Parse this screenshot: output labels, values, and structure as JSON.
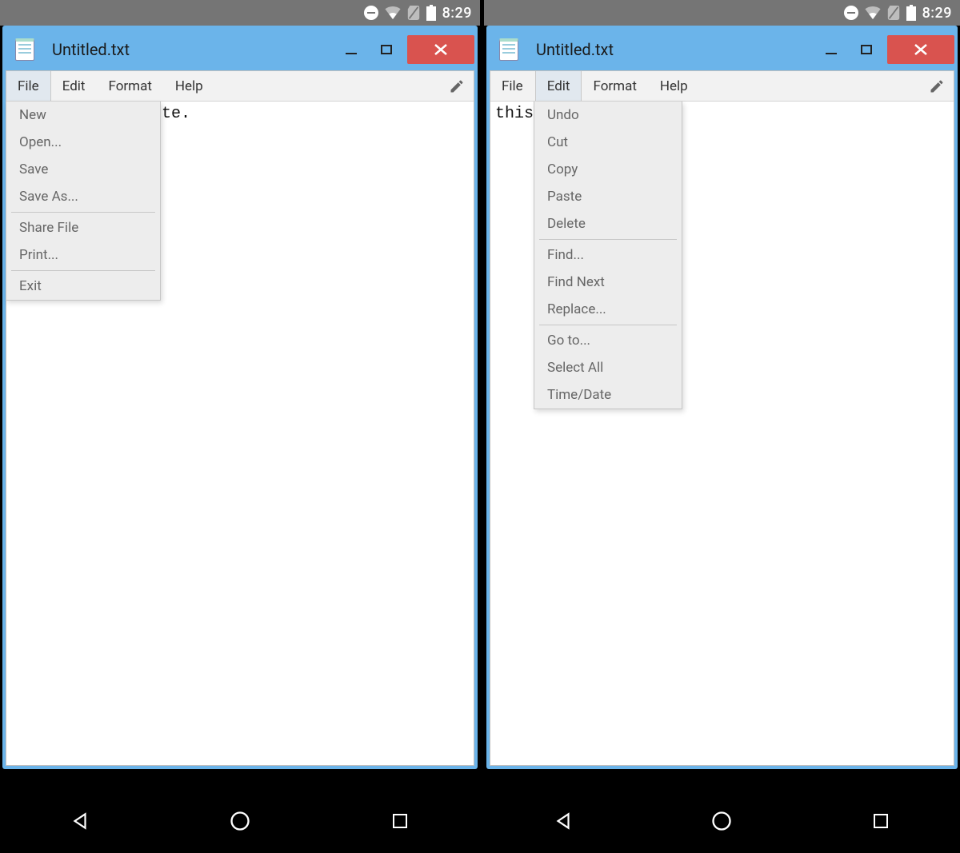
{
  "status": {
    "time": "8:29"
  },
  "left": {
    "title": "Untitled.txt",
    "menubar": {
      "file": "File",
      "edit": "Edit",
      "format": "Format",
      "help": "Help"
    },
    "text_visible": "te.",
    "file_menu": {
      "items": [
        {
          "label": "New"
        },
        {
          "label": "Open..."
        },
        {
          "label": "Save"
        },
        {
          "label": "Save As..."
        },
        {
          "sep": true
        },
        {
          "label": "Share File"
        },
        {
          "label": "Print..."
        },
        {
          "sep": true
        },
        {
          "label": "Exit"
        }
      ]
    }
  },
  "right": {
    "title": "Untitled.txt",
    "menubar": {
      "file": "File",
      "edit": "Edit",
      "format": "Format",
      "help": "Help"
    },
    "text_visible": "this",
    "edit_menu": {
      "items": [
        {
          "label": "Undo"
        },
        {
          "label": "Cut"
        },
        {
          "label": "Copy"
        },
        {
          "label": "Paste"
        },
        {
          "label": "Delete"
        },
        {
          "sep": true
        },
        {
          "label": "Find..."
        },
        {
          "label": "Find Next"
        },
        {
          "label": "Replace..."
        },
        {
          "sep": true
        },
        {
          "label": "Go to..."
        },
        {
          "label": "Select All"
        },
        {
          "label": "Time/Date"
        }
      ]
    }
  }
}
